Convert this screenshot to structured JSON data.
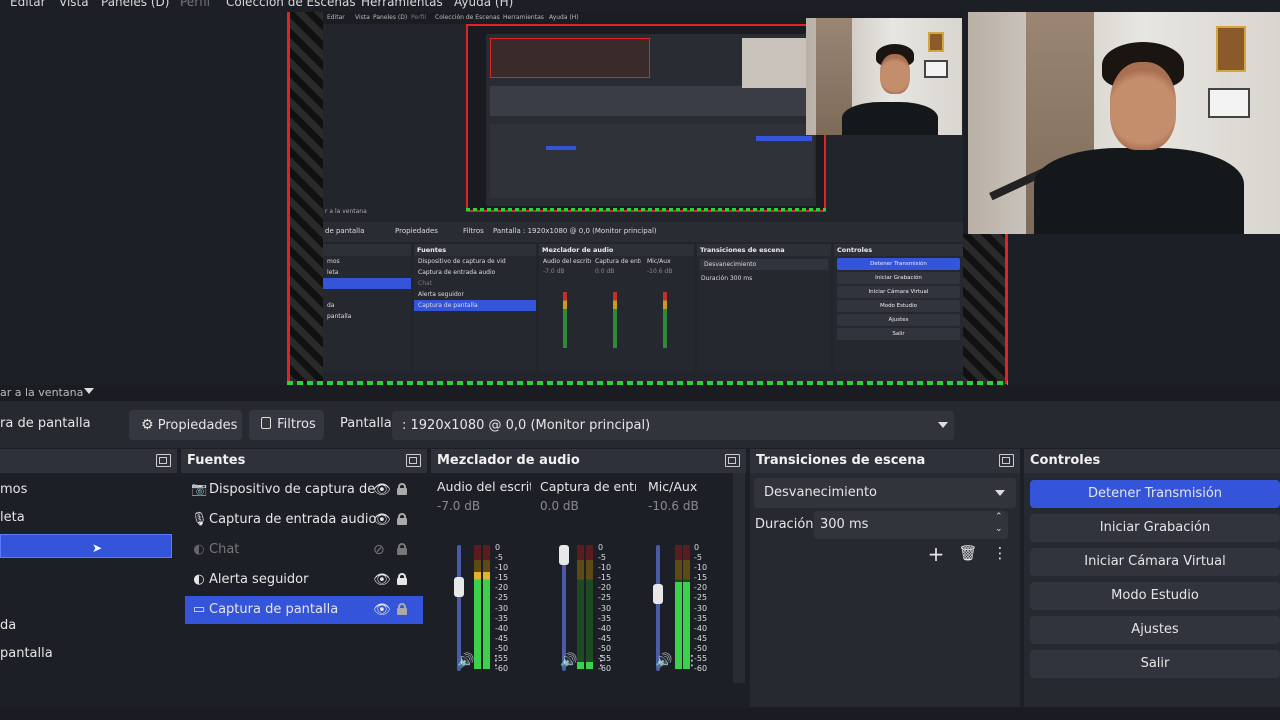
{
  "menu": [
    "Editar",
    "Vista",
    "Paneles (D)",
    "Perfil",
    "Colección de Escenas",
    "Herramientas",
    "Ayuda (H)"
  ],
  "nested": {
    "menu": [
      "Editar",
      "Vista",
      "Paneles (D)",
      "Perfil",
      "Colección de Escenas",
      "Herramientas",
      "Ayuda (H)"
    ],
    "hint": "r a la ventana",
    "toolbar": {
      "source": "de pantalla",
      "props": "Propiedades",
      "filters": "Filtros",
      "pantalla": "Pantalla",
      "monitor": ": 1920x1080 @ 0,0 (Monitor principal)"
    },
    "scenes_title": "",
    "scenes": [
      "mos",
      "leta",
      "",
      "",
      "da",
      "pantalla"
    ],
    "sources_title": "Fuentes",
    "sources": [
      "Dispositivo de captura de vid",
      "Captura de entrada audio",
      "Chat",
      "Alerta seguidor",
      "Captura de pantalla"
    ],
    "mixer_title": "Mezclador de audio",
    "mixer": [
      {
        "name": "Audio del escrito",
        "db": "-7.0 dB"
      },
      {
        "name": "Captura de entra",
        "db": "0.0 dB"
      },
      {
        "name": "Mic/Aux",
        "db": "-10.6 dB"
      }
    ],
    "transitions_title": "Transiciones de escena",
    "transition": "Desvanecimiento",
    "duration_label": "Duración",
    "duration": "300 ms",
    "controls_title": "Controles",
    "controls": [
      "Detener Transmisión",
      "Iniciar Grabación",
      "Iniciar Cámara Virtual",
      "Modo Estudio",
      "Ajustes",
      "Salir"
    ]
  },
  "hint_bar": {
    "text": "ar a la ventana"
  },
  "toolbar": {
    "source_name": "ra de pantalla",
    "properties": "Propiedades",
    "filters": "Filtros",
    "pantalla_label": "Pantalla",
    "monitor_value": ": 1920x1080 @ 0,0 (Monitor principal)"
  },
  "scenes": {
    "items": [
      "mos",
      "leta",
      "",
      "",
      "da",
      "pantalla"
    ],
    "selected_index": 2
  },
  "sources": {
    "title": "Fuentes",
    "items": [
      {
        "label": "Dispositivo de captura de vid",
        "icon": "camera-icon",
        "visible": true,
        "locked": false
      },
      {
        "label": "Captura de entrada audio",
        "icon": "microphone-icon",
        "visible": true,
        "locked": false
      },
      {
        "label": "Chat",
        "icon": "globe-icon",
        "visible": false,
        "locked": false
      },
      {
        "label": "Alerta seguidor",
        "icon": "globe-icon",
        "visible": true,
        "locked": true
      },
      {
        "label": "Captura de pantalla",
        "icon": "monitor-icon",
        "visible": true,
        "locked": false,
        "selected": true
      }
    ]
  },
  "mixer": {
    "title": "Mezclador de audio",
    "channels": [
      {
        "name": "Audio del escritc",
        "db": "-7.0 dB",
        "fader": 0.7,
        "level": 0.78
      },
      {
        "name": "Captura de entra",
        "db": "0.0 dB",
        "fader": 1.0,
        "level": 0.06
      },
      {
        "name": "Mic/Aux",
        "db": "-10.6 dB",
        "fader": 0.63,
        "level": 0.7
      }
    ],
    "scale": [
      "0",
      "-5",
      "-10",
      "-15",
      "-20",
      "-25",
      "-30",
      "-35",
      "-40",
      "-45",
      "-50",
      "-55",
      "-60"
    ]
  },
  "transitions": {
    "title": "Transiciones de escena",
    "selected": "Desvanecimiento",
    "duration_label": "Duración",
    "duration_value": "300 ms"
  },
  "controls": {
    "title": "Controles",
    "buttons": [
      "Detener Transmisión",
      "Iniciar Grabación",
      "Iniciar Cámara Virtual",
      "Modo Estudio",
      "Ajustes",
      "Salir"
    ]
  },
  "colors": {
    "accent": "#3455d9",
    "panel": "#272930",
    "background": "#1d1f26",
    "border_red": "#e02424",
    "border_green": "#27d43a"
  }
}
